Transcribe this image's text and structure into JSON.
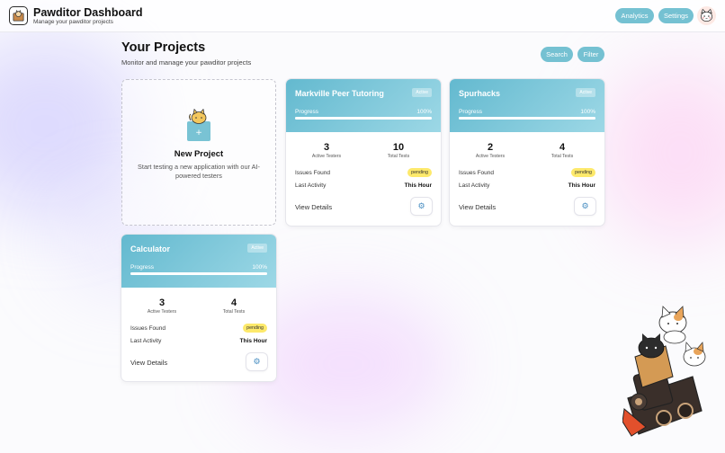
{
  "app": {
    "title": "Pawditor Dashboard",
    "subtitle": "Manage your pawditor projects"
  },
  "nav": {
    "analytics": "Analytics",
    "settings": "Settings"
  },
  "page": {
    "title": "Your Projects",
    "subtitle": "Monitor and manage your pawditor projects"
  },
  "actions": {
    "search": "Search",
    "filter": "Filter"
  },
  "new_project": {
    "title": "New Project",
    "description": "Start testing a new application with our AI-powered testers"
  },
  "labels": {
    "progress": "Progress",
    "active_testers": "Active Testers",
    "total_tests": "Total Tests",
    "issues_found": "Issues Found",
    "last_activity": "Last Activity",
    "view_details": "View Details"
  },
  "projects": [
    {
      "name": "Markville Peer Tutoring",
      "status": "Active",
      "progress": "100%",
      "progress_fraction": 1.0,
      "active_testers": "3",
      "total_tests": "10",
      "issues": "pending",
      "last_activity": "This Hour"
    },
    {
      "name": "Spurhacks",
      "status": "Active",
      "progress": "100%",
      "progress_fraction": 1.0,
      "active_testers": "2",
      "total_tests": "4",
      "issues": "pending",
      "last_activity": "This Hour"
    },
    {
      "name": "Calculator",
      "status": "Active",
      "progress": "100%",
      "progress_fraction": 1.0,
      "active_testers": "3",
      "total_tests": "4",
      "issues": "pending",
      "last_activity": "This Hour"
    }
  ],
  "colors": {
    "accent": "#75c1d2",
    "card_gradient_start": "#63b9cf",
    "card_gradient_end": "#9dd8e6",
    "pending": "#fde96b"
  },
  "icons": {
    "logo": "cat-logo-icon",
    "avatar": "cat-face-icon",
    "new_project": "cat-box-icon",
    "gear": "gear-icon",
    "mascot": "cat-train-icon"
  }
}
